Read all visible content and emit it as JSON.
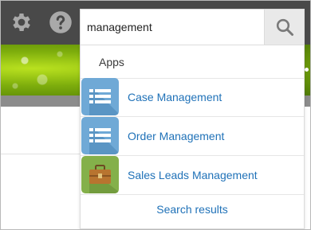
{
  "search": {
    "query": "management"
  },
  "dropdown": {
    "section_header": "Apps",
    "apps": [
      {
        "label": "Case Management",
        "icon": "list-icon",
        "color": "#6fa9d6"
      },
      {
        "label": "Order Management",
        "icon": "list-icon",
        "color": "#6fa9d6"
      },
      {
        "label": "Sales Leads Management",
        "icon": "briefcase-icon",
        "color": "#84b04a"
      }
    ],
    "search_results_label": "Search results"
  },
  "colors": {
    "topbar": "#494949",
    "link": "#2072b8"
  }
}
